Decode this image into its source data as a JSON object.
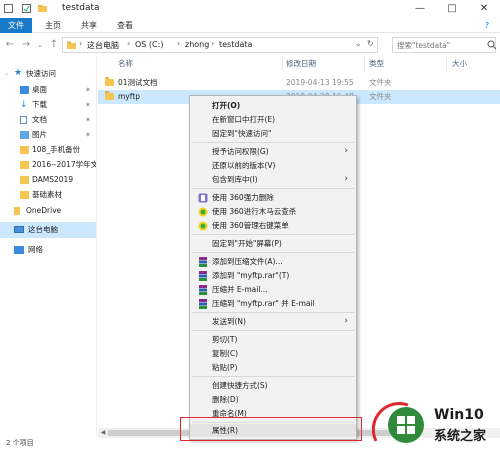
{
  "window": {
    "title": "testdata"
  },
  "ribbon": {
    "tabs": [
      "文件",
      "主页",
      "共享",
      "查看"
    ]
  },
  "address": {
    "crumbs": [
      "这台电脑",
      "OS (C:)",
      "zhong",
      "testdata"
    ],
    "search_placeholder": "搜索\"testdata\""
  },
  "sidebar": {
    "items": [
      {
        "label": "快速访问"
      },
      {
        "label": "桌面"
      },
      {
        "label": "下载"
      },
      {
        "label": "文档"
      },
      {
        "label": "图片"
      },
      {
        "label": "108_手机备份"
      },
      {
        "label": "2016--2017学年文"
      },
      {
        "label": "DAMS2019"
      },
      {
        "label": "基础素材"
      },
      {
        "label": "OneDrive"
      },
      {
        "label": "这台电脑"
      },
      {
        "label": "网络"
      }
    ]
  },
  "columns": {
    "name": "名称",
    "date": "修改日期",
    "type": "类型",
    "size": "大小"
  },
  "files": [
    {
      "name": "01测试文档",
      "date": "2019-04-13 19:55",
      "type": "文件夹"
    },
    {
      "name": "myftp",
      "date": "2019-04-20 16:48",
      "type": "文件夹"
    }
  ],
  "status": {
    "text": "2 个项目"
  },
  "context_menu": {
    "items": [
      "打开(O)",
      "在新窗口中打开(E)",
      "固定到\"快速访问\"",
      "授予访问权限(G)",
      "还原以前的版本(V)",
      "包含到库中(I)",
      "使用 360强力删除",
      "使用 360进行木马云查杀",
      "使用 360管理右键菜单",
      "固定到\"开始\"屏幕(P)",
      "添加到压缩文件(A)...",
      "添加到 \"myftp.rar\"(T)",
      "压缩并 E-mail...",
      "压缩到 \"myftp.rar\" 并 E-mail",
      "发送到(N)",
      "剪切(T)",
      "复制(C)",
      "粘贴(P)",
      "创建快捷方式(S)",
      "删除(D)",
      "重命名(M)",
      "属性(R)"
    ]
  },
  "watermark": {
    "line1": "Win10",
    "line2": "系统之家"
  },
  "colors": {
    "accent": "#1979ca",
    "selection": "#cce8ff",
    "highlight": "#e0262e"
  }
}
